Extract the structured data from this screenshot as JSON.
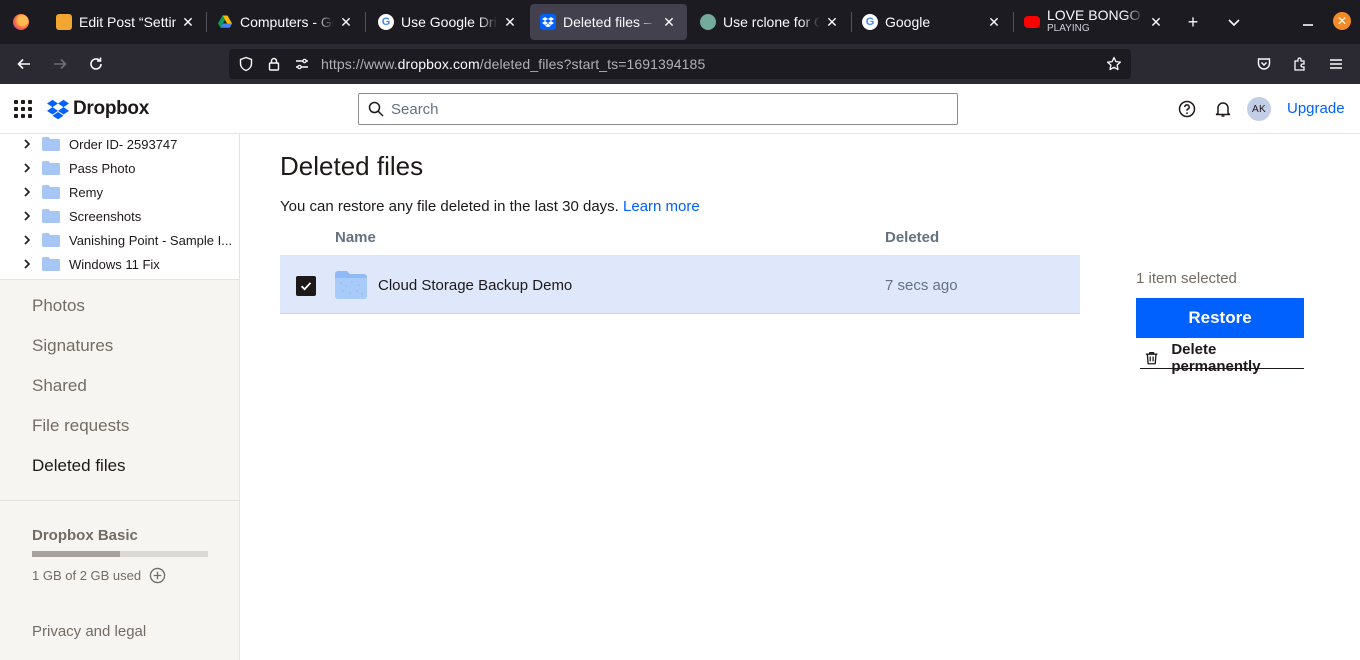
{
  "browser": {
    "tabs": [
      {
        "title": "Edit Post “Setting",
        "favicon": "foss-linux-favicon"
      },
      {
        "title": "Computers - Goog",
        "favicon": "google-drive-favicon"
      },
      {
        "title": "Use Google Drive",
        "favicon": "google-favicon"
      },
      {
        "title": "Deleted files – Dr",
        "favicon": "dropbox-favicon",
        "active": true
      },
      {
        "title": "Use rclone for Go",
        "favicon": "chatgpt-favicon"
      },
      {
        "title": "Google",
        "favicon": "google-favicon"
      },
      {
        "title": "LOVE BONGO MIX",
        "subtitle": "PLAYING",
        "favicon": "youtube-favicon"
      }
    ],
    "url_prefix": "https://www.",
    "url_domain": "dropbox.com",
    "url_path": "/deleted_files?start_ts=1691394185"
  },
  "header": {
    "brand": "Dropbox",
    "search_placeholder": "Search",
    "avatar_initials": "AK",
    "upgrade_label": "Upgrade"
  },
  "sidebar": {
    "tree": [
      {
        "label": "Order ID- 2593747"
      },
      {
        "label": "Pass Photo"
      },
      {
        "label": "Remy"
      },
      {
        "label": "Screenshots"
      },
      {
        "label": "Vanishing Point - Sample I..."
      },
      {
        "label": "Windows 11 Fix"
      }
    ],
    "nav": [
      {
        "label": "Photos"
      },
      {
        "label": "Signatures"
      },
      {
        "label": "Shared"
      },
      {
        "label": "File requests"
      },
      {
        "label": "Deleted files",
        "active": true
      }
    ],
    "plan": {
      "name": "Dropbox Basic",
      "usage_text": "1 GB of 2 GB used",
      "usage_fraction": 0.5
    },
    "privacy_label": "Privacy and legal"
  },
  "main": {
    "title": "Deleted files",
    "intro_text": "You can restore any file deleted in the last 30 days.",
    "learn_more": "Learn more",
    "columns": {
      "name": "Name",
      "deleted": "Deleted"
    },
    "rows": [
      {
        "name": "Cloud Storage Backup Demo",
        "deleted": "7 secs ago",
        "selected": true
      }
    ],
    "selection": {
      "count_text": "1 item selected",
      "restore_label": "Restore",
      "delete_label": "Delete permanently"
    }
  },
  "colors": {
    "accent": "#0061fe",
    "selected_row": "#dfe8fb",
    "folder": "#8fbaf7"
  }
}
